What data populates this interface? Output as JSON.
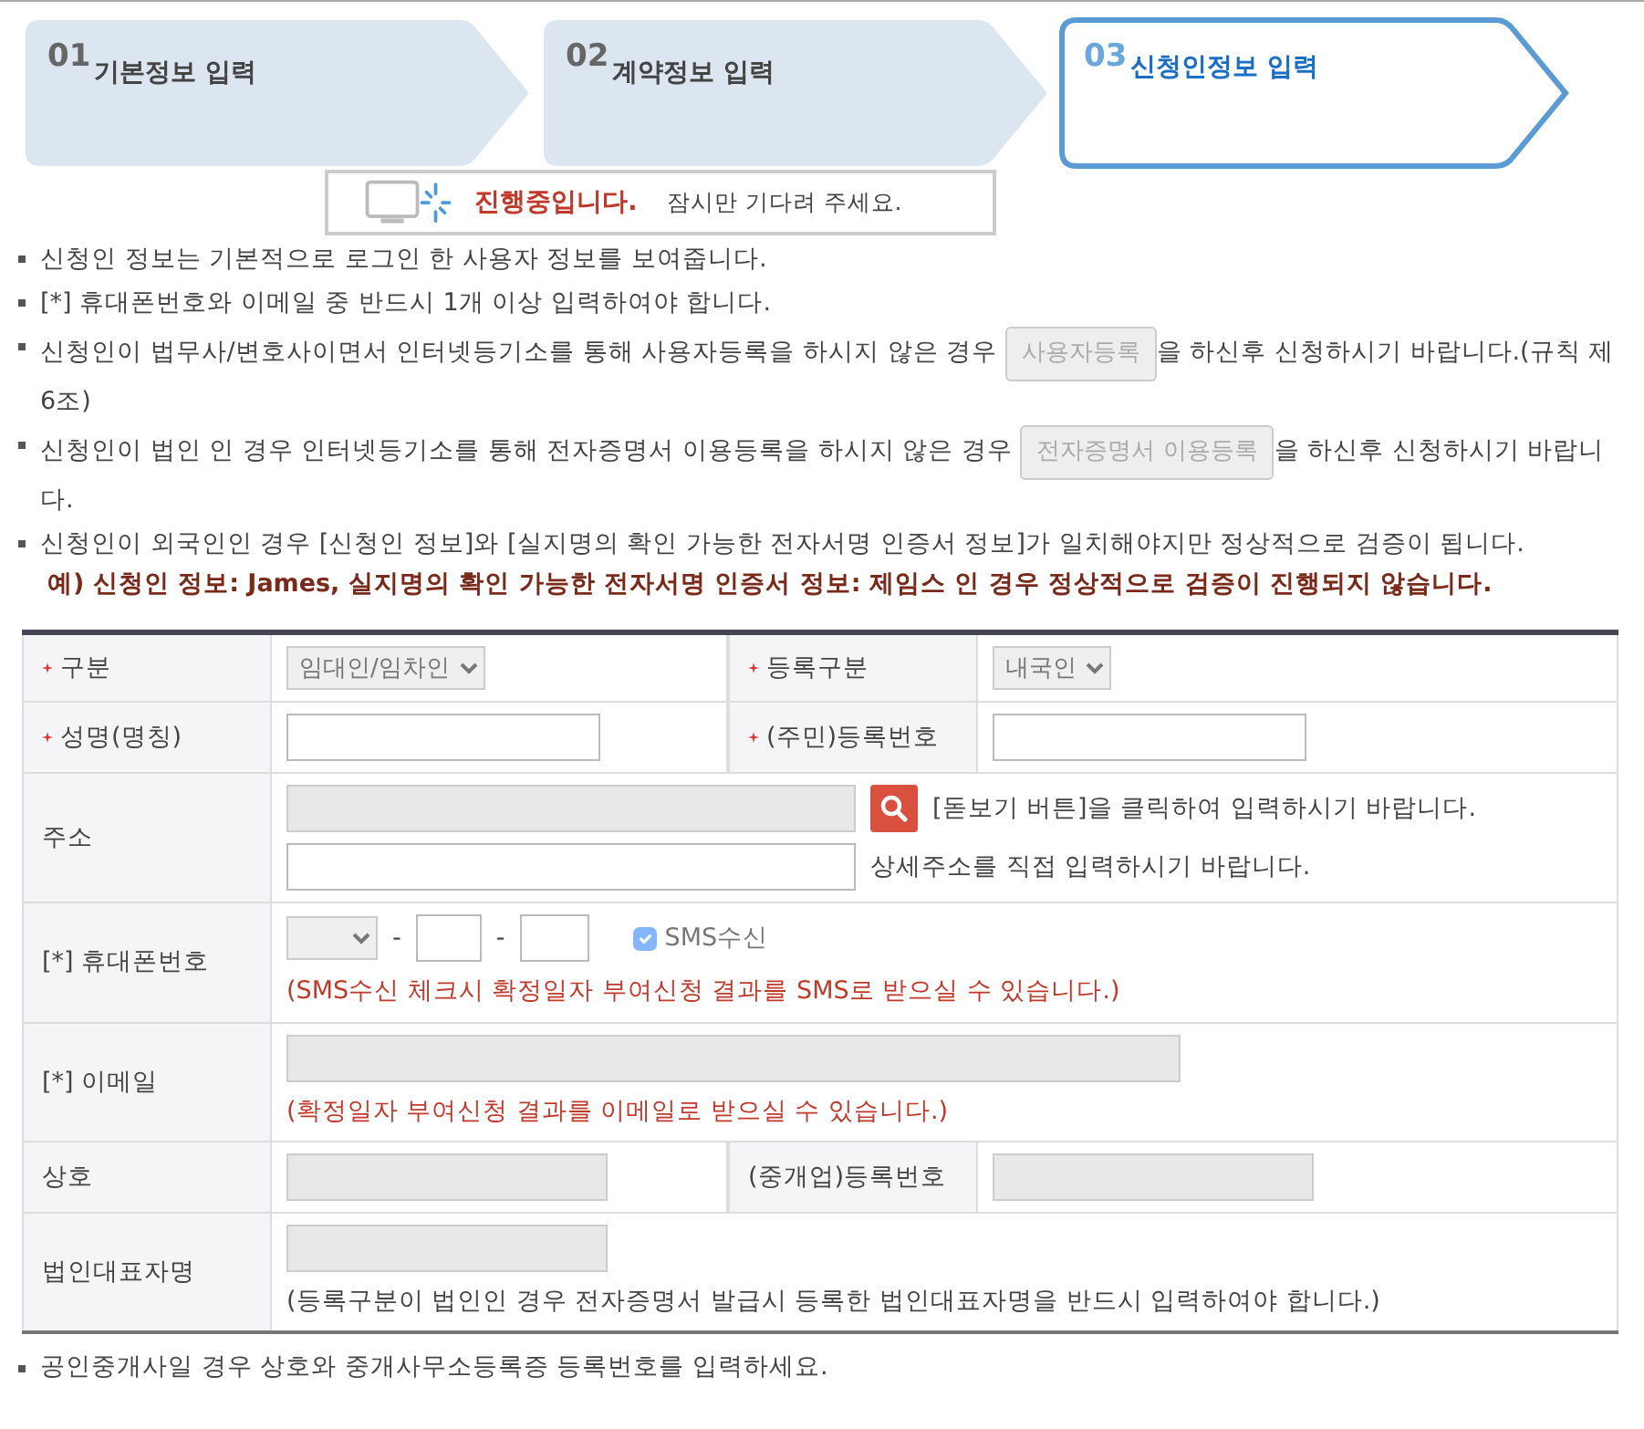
{
  "steps": [
    {
      "number": "01",
      "label": "기본정보 입력",
      "selected": false
    },
    {
      "number": "02",
      "label": "계약정보 입력",
      "selected": false
    },
    {
      "number": "03",
      "label": "신청인정보 입력",
      "selected": true
    }
  ],
  "loading": {
    "title": "진행중입니다.",
    "message": "잠시만 기다려 주세요."
  },
  "notices": [
    {
      "text": "신청인 정보는 기본적으로 로그인 한 사용자 정보를 보여줍니다."
    },
    {
      "text": "[*] 휴대폰번호와 이메일 중 반드시 1개 이상 입력하여야 합니다."
    },
    {
      "text": "신청인이 법무사/변호사이면서 인터넷등기소를 통해 사용자등록을 하시지 않은 경우",
      "button": "사용자등록",
      "after": "을 하신후 신청하시기 바랍니다.(규칙 제6조)"
    },
    {
      "text": "신청인이 법인 인 경우 인터넷등기소를 통해 전자증명서 이용등록을 하시지 않은 경우",
      "button": "전자증명서 이용등록",
      "after": "을 하신후 신청하시기 바랍니다."
    },
    {
      "text": "신청인이 외국인인 경우 [신청인 정보]와 [실지명의 확인 가능한 전자서명 인증서 정보]가 일치해야지만 정상적으로 검증이 됩니다.",
      "example": "예) 신청인 정보: James, 실지명의 확인 가능한 전자서명 인증서 정보: 제임스 인 경우 정상적으로 검증이 진행되지 않습니다."
    }
  ],
  "form": [
    {
      "kind": "pair",
      "fields": [
        {
          "label": "구분",
          "required": true,
          "kind": "select",
          "value": "임대인/임차인"
        },
        {
          "label": "등록구분",
          "required": true,
          "kind": "select",
          "value": "내국인"
        }
      ]
    },
    {
      "kind": "pair",
      "fields": [
        {
          "label": "성명(명칭)",
          "required": true,
          "kind": "text"
        },
        {
          "label": "(주민)등록번호",
          "required": true,
          "kind": "text"
        }
      ]
    },
    {
      "kind": "address",
      "label": "주소",
      "search_hint": "[돋보기 버튼]을 클릭하여 입력하시기 바랍니다.",
      "detail_hint": "상세주소를 직접 입력하시기 바랍니다."
    },
    {
      "kind": "phone",
      "prefix": "[*]",
      "label": "휴대폰번호",
      "separators": [
        "-",
        "-"
      ],
      "sms": {
        "label": "SMS수신",
        "checked": true,
        "disabled": true
      },
      "note": "(SMS수신 체크시 확정일자 부여신청 결과를 SMS로 받으실 수 있습니다.)"
    },
    {
      "kind": "email",
      "prefix": "[*]",
      "label": "이메일",
      "note": "(확정일자 부여신청 결과를 이메일로 받으실 수 있습니다.)"
    },
    {
      "kind": "pair",
      "fields": [
        {
          "label": "상호",
          "required": false,
          "kind": "readonly"
        },
        {
          "label": "(중개업)등록번호",
          "required": false,
          "kind": "readonly"
        }
      ]
    },
    {
      "kind": "note",
      "label": "법인대표자명",
      "note": "(등록구분이 법인인 경우 전자증명서 발급시 등록한 법인대표자명을 반드시 입력하여야 합니다.)"
    }
  ],
  "footer": "공인중개사일 경우 상호와 중개사무소등록증 등록번호를 입력하세요."
}
